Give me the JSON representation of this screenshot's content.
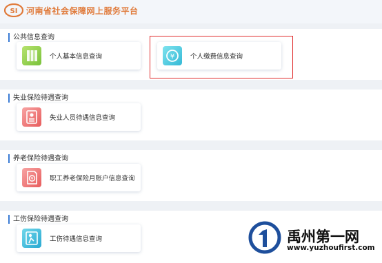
{
  "header": {
    "site_title": "河南省社会保障网上服务平台",
    "logo_text": "SI"
  },
  "sections": [
    {
      "title": "公共信息查询",
      "cards": [
        {
          "label": "个人基本信息查询",
          "icon": "document-grid-icon"
        },
        {
          "label": "个人缴费信息查询",
          "icon": "yen-refresh-icon"
        }
      ]
    },
    {
      "title": "失业保险待遇查询",
      "cards": [
        {
          "label": "失业人员待遇信息查询",
          "icon": "person-card-icon"
        }
      ]
    },
    {
      "title": "养老保险待遇查询",
      "cards": [
        {
          "label": "职工养老保险月账户信息查询",
          "icon": "yen-document-icon"
        }
      ]
    },
    {
      "title": "工伤保险待遇查询",
      "cards": [
        {
          "label": "工伤待遇信息查询",
          "icon": "injured-person-icon"
        }
      ]
    }
  ],
  "watermark": {
    "title": "禹州第一网",
    "url": "www.yuzhoufirst.com"
  },
  "colors": {
    "accent": "#3a7bd5",
    "highlight": "#e02a2a",
    "brand": "#e07a3a"
  }
}
